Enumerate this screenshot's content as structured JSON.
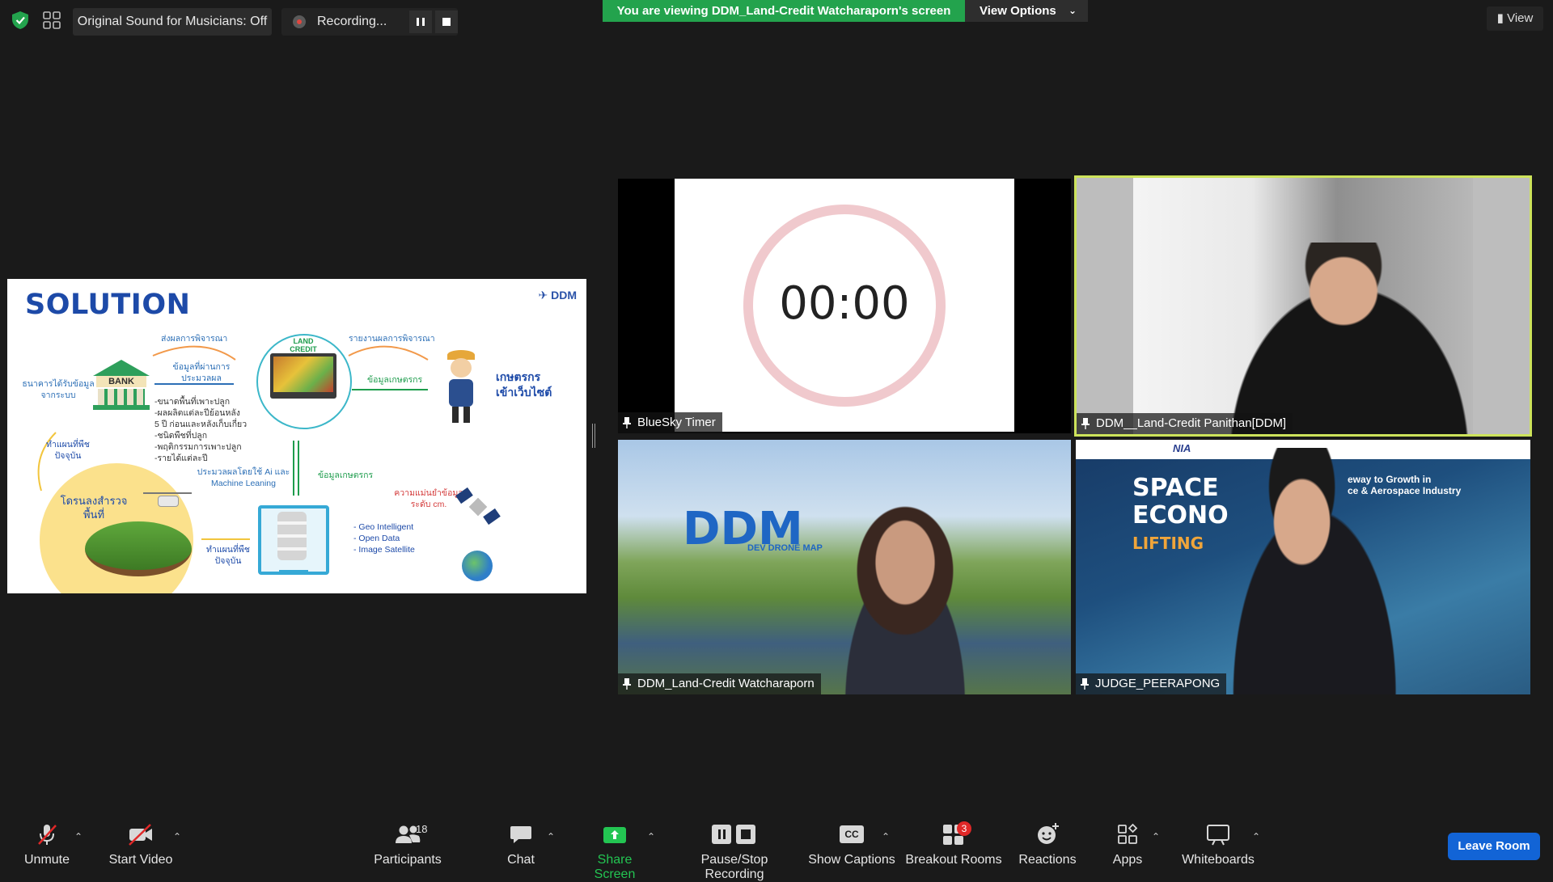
{
  "topbar": {
    "original_sound": "Original Sound for Musicians: Off",
    "recording": "Recording...",
    "viewing_banner": "You are viewing DDM_Land-Credit Watcharaporn's screen",
    "view_options": "View Options",
    "view": "View"
  },
  "slide": {
    "title": "SOLUTION",
    "logo": "DDM",
    "land_credit": "LAND CREDIT",
    "send_results": "ส่งผลการพิจารณา",
    "report_results": "รายงานผลการพิจารณา",
    "processed_data": "ข้อมูลที่ผ่านการประมวลผล",
    "farmer_data": "ข้อมูลเกษตรกร",
    "bank": "BANK",
    "bank_receives": "ธนาคารได้รับข้อมูลจากระบบ",
    "farmer_visit": "เกษตรกรเข้าเว็บไซต์",
    "details": [
      "-ขนาดพื้นที่เพาะปลูก",
      "-ผลผลิตแต่ละปีย้อนหลัง",
      "5 ปี ก่อนและหลังเก็บเกี่ยว",
      "-ชนิดพืชที่ปลูก",
      "-พฤติกรรมการเพาะปลูก",
      "-รายได้แต่ละปี"
    ],
    "ai_processing": "ประมวลผลโดยใช้ Ai และ Machine Leaning",
    "farmer_data2": "ข้อมูลเกษตรกร",
    "current_map": "ทำแผนที่พืชปัจจุบัน",
    "current_map2": "ทำแผนที่พืชปัจจุบัน",
    "drone_survey": "โดรนลงสำรวจพื้นที่",
    "accuracy": "ความแม่นยำข้อมูลระดับ cm.",
    "sources": [
      "- Geo Intelligent",
      "- Open Data",
      "- Image Satellite"
    ]
  },
  "participants_tiles": [
    {
      "name": "BlueSky Timer",
      "timer": "00:00"
    },
    {
      "name": "DDM__Land-Credit Panithan[DDM]"
    },
    {
      "name": "DDM_Land-Credit Watcharaporn",
      "bg_logo": "DDM",
      "bg_sub": "DEV DRONE MAP"
    },
    {
      "name": "JUDGE_PEERAPONG",
      "bg_title1": "SPACE",
      "bg_title2": "ECONO",
      "bg_title3": "LIFTING",
      "bg_line1": "eway to Growth in",
      "bg_line2": "ce & Aerospace Industry",
      "bg_brand": "NIA"
    }
  ],
  "toolbar": {
    "unmute": "Unmute",
    "start_video": "Start Video",
    "participants": "Participants",
    "participants_count": "18",
    "chat": "Chat",
    "share_screen": "Share Screen",
    "pause_stop": "Pause/Stop Recording",
    "captions_icon": "CC",
    "show_captions": "Show Captions",
    "breakout_rooms": "Breakout Rooms",
    "breakout_badge": "3",
    "reactions": "Reactions",
    "apps": "Apps",
    "whiteboards": "Whiteboards",
    "leave": "Leave Room"
  },
  "colors": {
    "banner_green": "#23a34d",
    "share_green": "#23c552",
    "leave_blue": "#1264d6",
    "active_speaker_border": "#cde35b",
    "badge_red": "#e02828"
  }
}
